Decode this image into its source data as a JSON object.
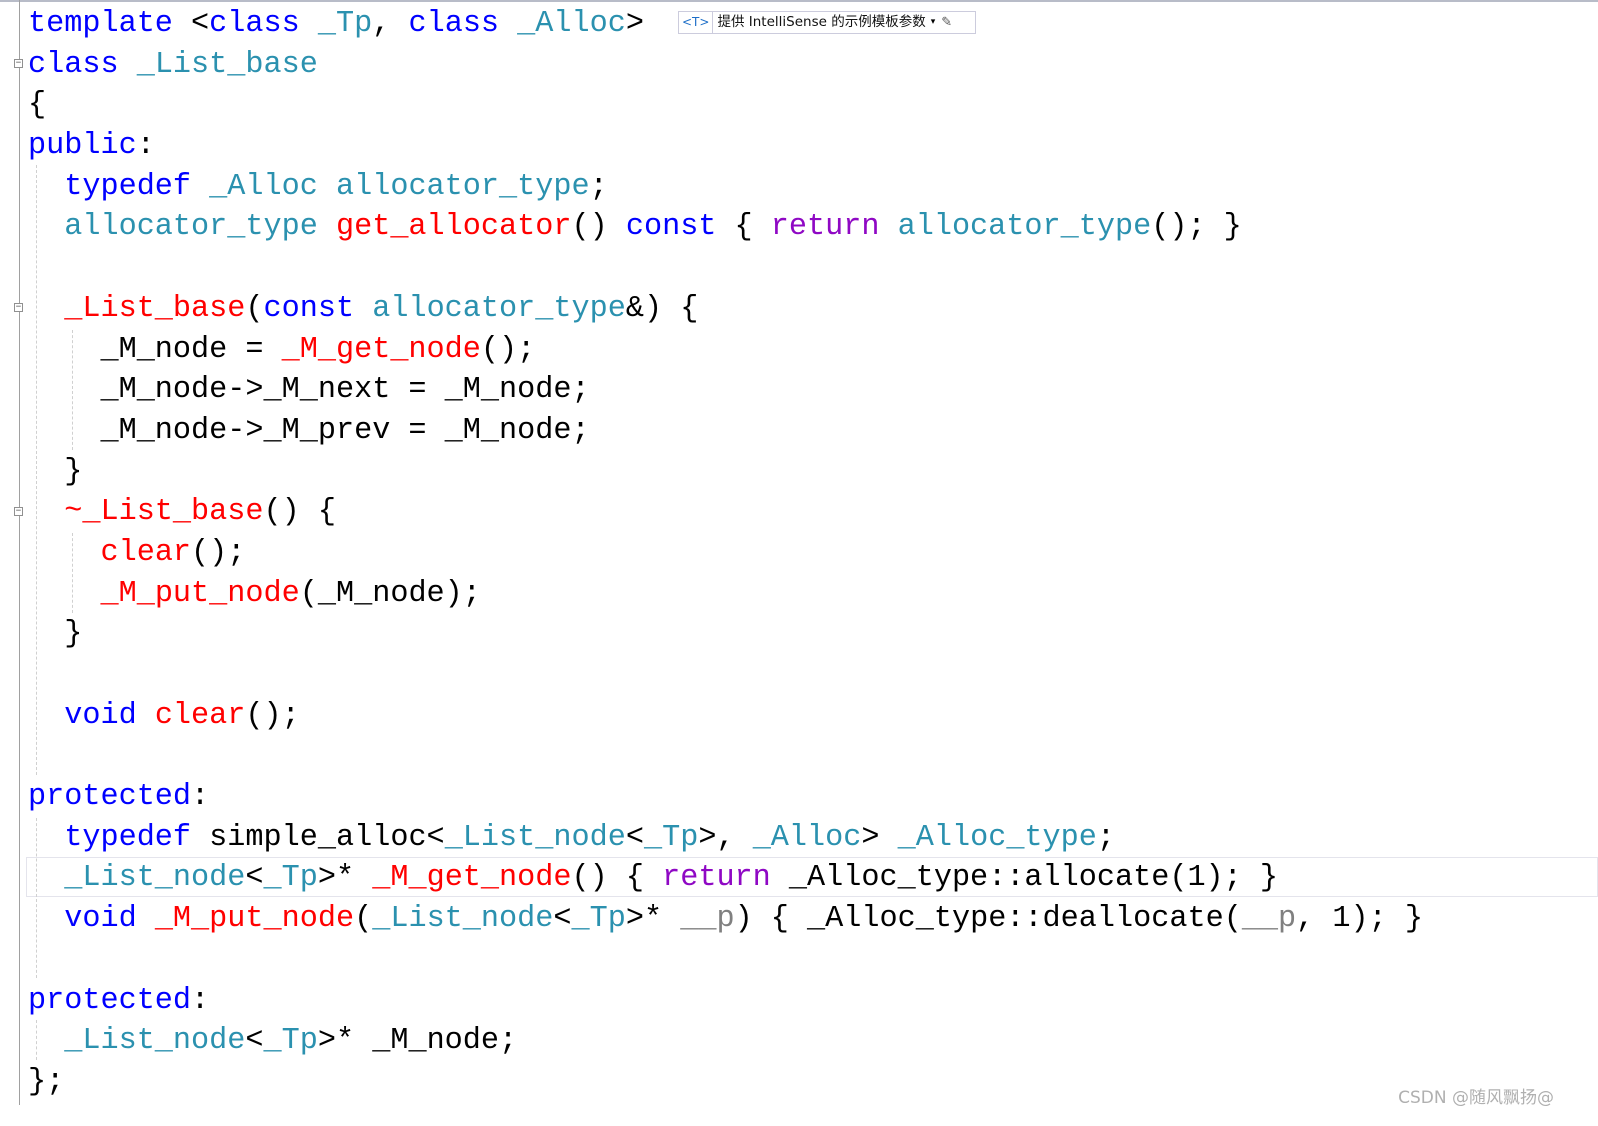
{
  "editor": {
    "lines": [
      [
        [
          "kw",
          "template "
        ],
        [
          "pl",
          "<"
        ],
        [
          "kw",
          "class "
        ],
        [
          "ty",
          "_Tp"
        ],
        [
          "pl",
          ", "
        ],
        [
          "kw",
          "class "
        ],
        [
          "ty",
          "_Alloc"
        ],
        [
          "pl",
          ">"
        ]
      ],
      [
        [
          "kw",
          "class "
        ],
        [
          "ty",
          "_List_base"
        ]
      ],
      [
        [
          "pl",
          "{"
        ]
      ],
      [
        [
          "kw",
          "public"
        ],
        [
          "pl",
          ":"
        ]
      ],
      [
        [
          "pl",
          "  "
        ],
        [
          "kw",
          "typedef "
        ],
        [
          "ty",
          "_Alloc allocator_type"
        ],
        [
          "pl",
          ";"
        ]
      ],
      [
        [
          "pl",
          "  "
        ],
        [
          "ty",
          "allocator_type "
        ],
        [
          "fn",
          "get_allocator"
        ],
        [
          "pl",
          "() "
        ],
        [
          "kw",
          "const"
        ],
        [
          "pl",
          " { "
        ],
        [
          "ctl",
          "return "
        ],
        [
          "ty",
          "allocator_type"
        ],
        [
          "pl",
          "(); }"
        ]
      ],
      [],
      [
        [
          "pl",
          "  "
        ],
        [
          "fn",
          "_List_base"
        ],
        [
          "pl",
          "("
        ],
        [
          "kw",
          "const "
        ],
        [
          "ty",
          "allocator_type"
        ],
        [
          "pl",
          "&) {"
        ]
      ],
      [
        [
          "pl",
          "    _M_node = "
        ],
        [
          "fn",
          "_M_get_node"
        ],
        [
          "pl",
          "();"
        ]
      ],
      [
        [
          "pl",
          "    _M_node->_M_next = _M_node;"
        ]
      ],
      [
        [
          "pl",
          "    _M_node->_M_prev = _M_node;"
        ]
      ],
      [
        [
          "pl",
          "  }"
        ]
      ],
      [
        [
          "pl",
          "  "
        ],
        [
          "fn",
          "~_List_base"
        ],
        [
          "pl",
          "() {"
        ]
      ],
      [
        [
          "pl",
          "    "
        ],
        [
          "fn",
          "clear"
        ],
        [
          "pl",
          "();"
        ]
      ],
      [
        [
          "pl",
          "    "
        ],
        [
          "fn",
          "_M_put_node"
        ],
        [
          "pl",
          "(_M_node);"
        ]
      ],
      [
        [
          "pl",
          "  }"
        ]
      ],
      [],
      [
        [
          "pl",
          "  "
        ],
        [
          "kw",
          "void "
        ],
        [
          "fn",
          "clear"
        ],
        [
          "pl",
          "();"
        ]
      ],
      [],
      [
        [
          "kw",
          "protected"
        ],
        [
          "pl",
          ":"
        ]
      ],
      [
        [
          "pl",
          "  "
        ],
        [
          "kw",
          "typedef "
        ],
        [
          "pl",
          "simple_alloc<"
        ],
        [
          "ty",
          "_List_node"
        ],
        [
          "pl",
          "<"
        ],
        [
          "ty",
          "_Tp"
        ],
        [
          "pl",
          ">, "
        ],
        [
          "ty",
          "_Alloc"
        ],
        [
          "pl",
          "> "
        ],
        [
          "ty",
          "_Alloc_type"
        ],
        [
          "pl",
          ";"
        ]
      ],
      [
        [
          "pl",
          "  "
        ],
        [
          "ty",
          "_List_node"
        ],
        [
          "pl",
          "<"
        ],
        [
          "ty",
          "_Tp"
        ],
        [
          "pl",
          ">* "
        ],
        [
          "fn",
          "_M_get_node"
        ],
        [
          "pl",
          "() { "
        ],
        [
          "ctl",
          "return "
        ],
        [
          "pl",
          "_Alloc_type::allocate(1); }"
        ]
      ],
      [
        [
          "pl",
          "  "
        ],
        [
          "kw",
          "void "
        ],
        [
          "fn",
          "_M_put_node"
        ],
        [
          "pl",
          "("
        ],
        [
          "ty",
          "_List_node"
        ],
        [
          "pl",
          "<"
        ],
        [
          "ty",
          "_Tp"
        ],
        [
          "pl",
          ">* "
        ],
        [
          "par",
          "__p"
        ],
        [
          "pl",
          ") { _Alloc_type::deallocate("
        ],
        [
          "par",
          "__p"
        ],
        [
          "pl",
          ", 1); }"
        ]
      ],
      [],
      [
        [
          "kw",
          "protected"
        ],
        [
          "pl",
          ":"
        ]
      ],
      [
        [
          "pl",
          "  "
        ],
        [
          "ty",
          "_List_node"
        ],
        [
          "pl",
          "<"
        ],
        [
          "ty",
          "_Tp"
        ],
        [
          "pl",
          ">* _M_node;"
        ]
      ],
      [
        [
          "pl",
          "};"
        ]
      ]
    ]
  },
  "hint": {
    "icon": "<T>",
    "label": "提供 IntelliSense 的示例模板参数",
    "dropdown": "▾",
    "edit_icon": "✎"
  },
  "watermark": "CSDN @随风飘扬@",
  "colors": {
    "keyword": "#0000ff",
    "type": "#2b91af",
    "function": "#ff0000",
    "control": "#8f08c4",
    "parameter": "#808080"
  }
}
